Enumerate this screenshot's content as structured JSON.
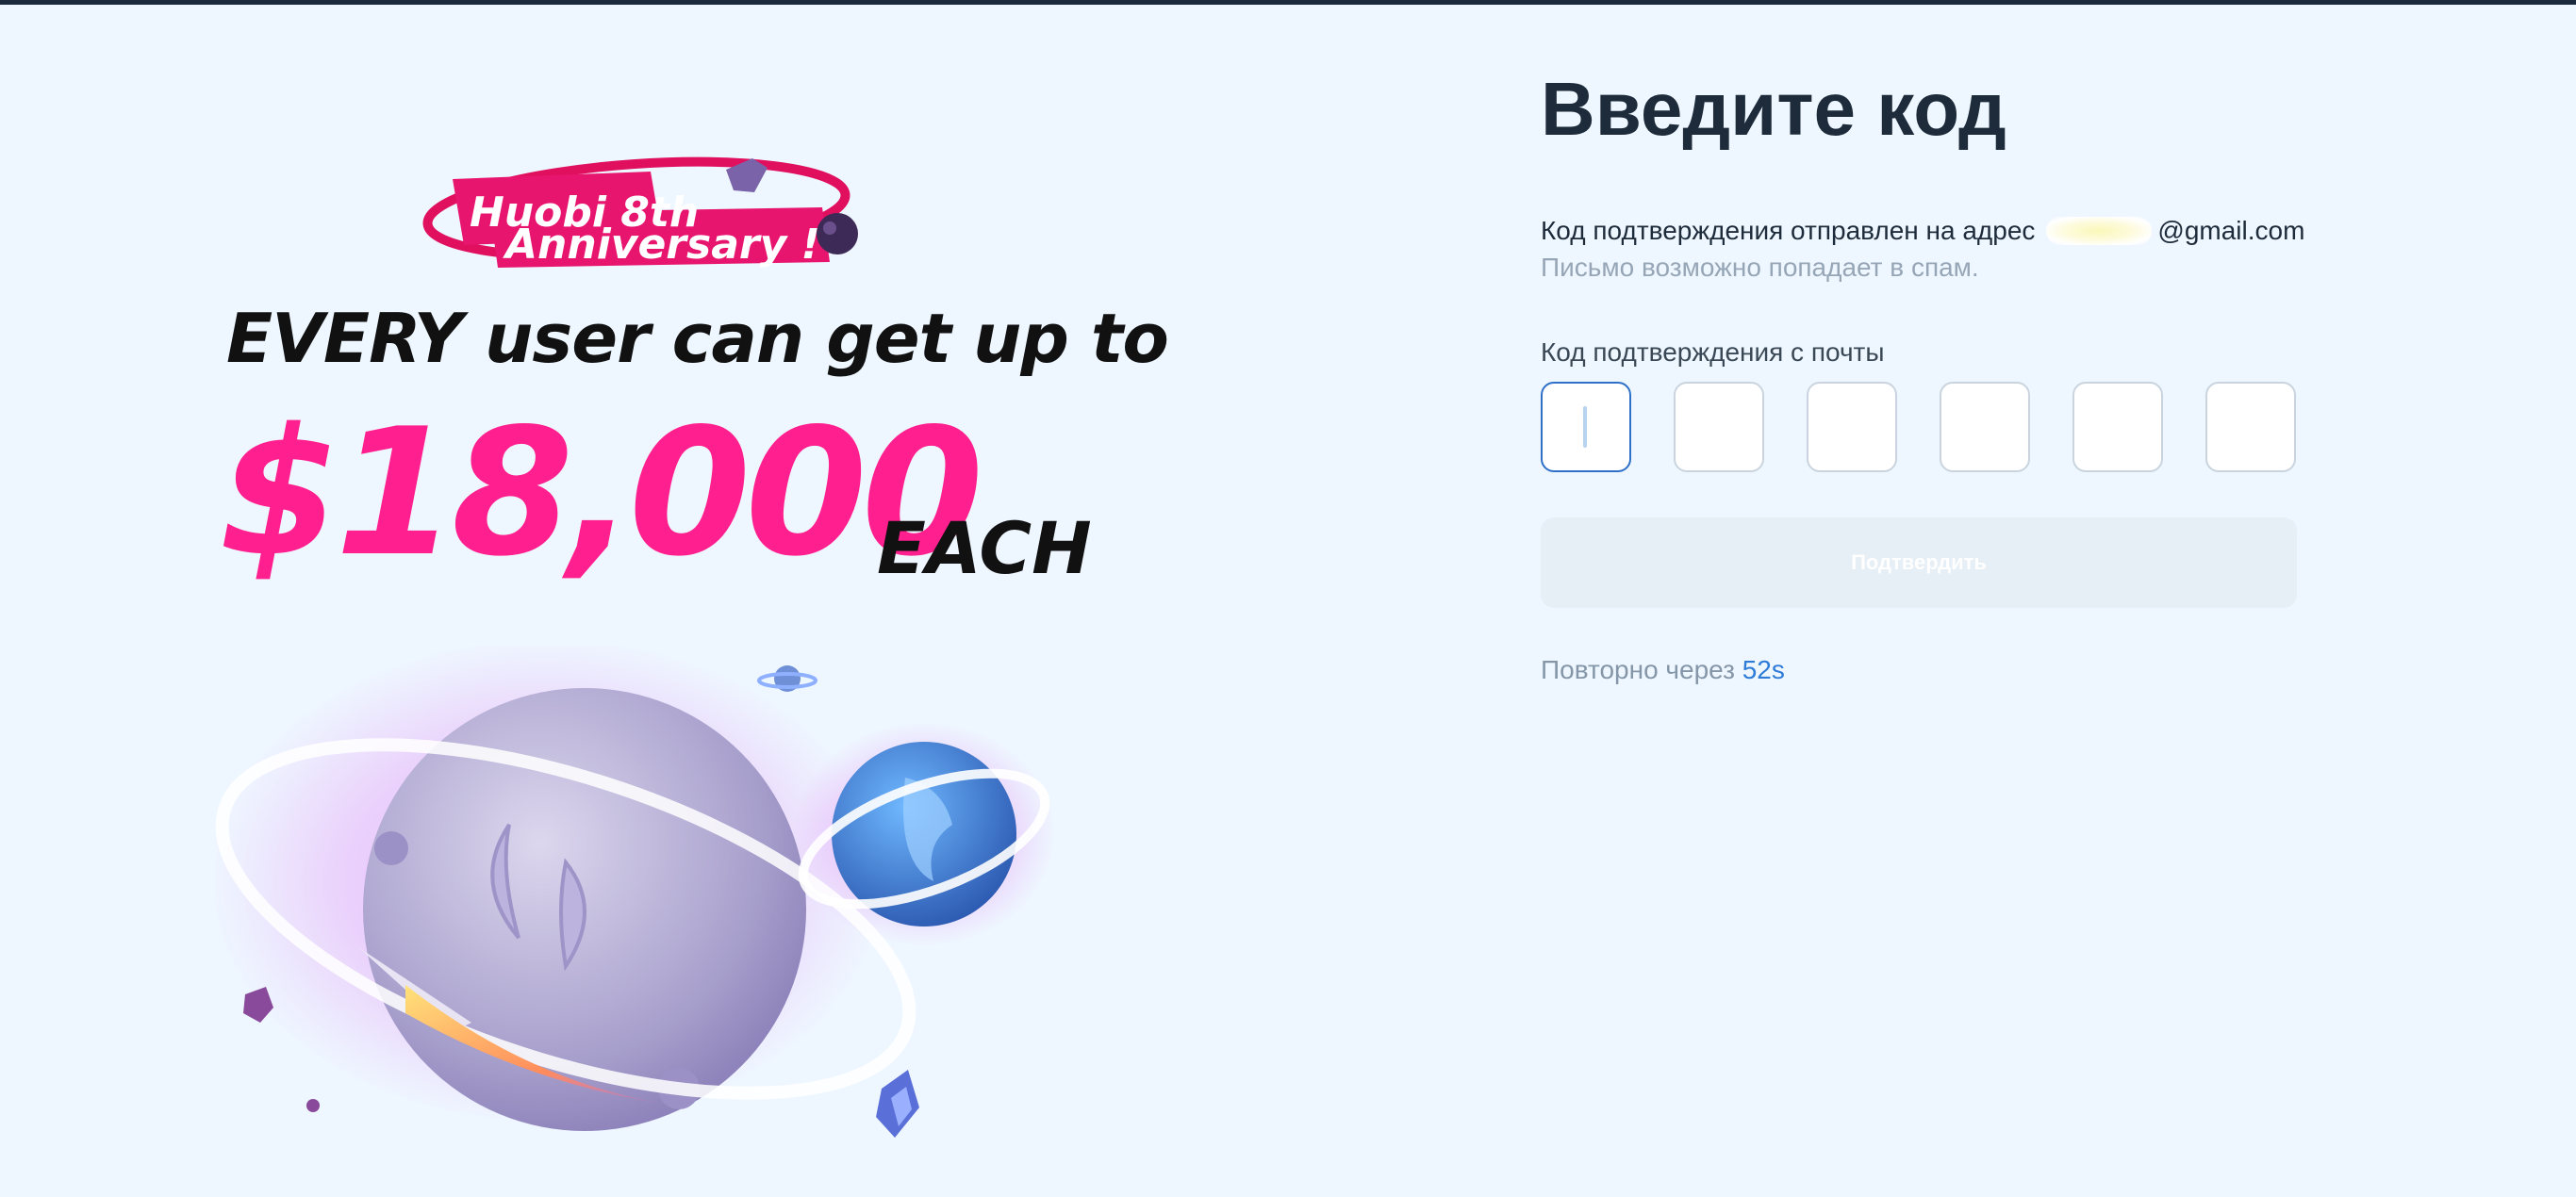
{
  "promo": {
    "badge_line1": "Huobi 8th",
    "badge_line2": "Anniversary !",
    "headline": "EVERY user can get up to",
    "amount": "$18,000",
    "amount_suffix": "EACH",
    "colors": {
      "accent": "#ff1f8e",
      "text": "#111111"
    }
  },
  "form": {
    "title": "Введите код",
    "sent_prefix": "Код подтверждения отправлен на адрес",
    "email_domain": "@gmail.com",
    "spam_hint": "Письмо возможно попадает в спам.",
    "code_label": "Код подтверждения с почты",
    "code_digits": [
      "",
      "",
      "",
      "",
      "",
      ""
    ],
    "submit_label": "Подтвердить",
    "resend_prefix": "Повторно через",
    "resend_timer": "52s",
    "colors": {
      "active_border": "#2f71c8",
      "timer": "#2f7bd8",
      "button_bg": "#e6eef6"
    }
  }
}
